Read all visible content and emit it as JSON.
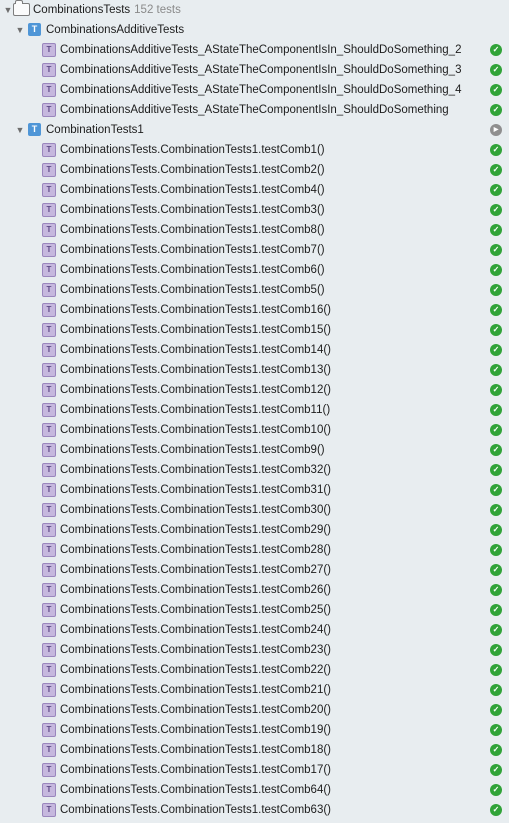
{
  "root": {
    "label": "CombinationsTests",
    "count": "152 tests",
    "disclosure": "▼"
  },
  "groups": [
    {
      "label": "CombinationsAdditiveTests",
      "disclosure": "▼",
      "icon_text": "T",
      "status": "",
      "tests": [
        {
          "label": "CombinationsAdditiveTests_AStateTheComponentIsIn_ShouldDoSomething_2",
          "status": "passed"
        },
        {
          "label": "CombinationsAdditiveTests_AStateTheComponentIsIn_ShouldDoSomething_3",
          "status": "passed"
        },
        {
          "label": "CombinationsAdditiveTests_AStateTheComponentIsIn_ShouldDoSomething_4",
          "status": "passed"
        },
        {
          "label": "CombinationsAdditiveTests_AStateTheComponentIsIn_ShouldDoSomething",
          "status": "passed"
        }
      ]
    },
    {
      "label": "CombinationTests1",
      "disclosure": "▼",
      "icon_text": "T",
      "status": "run",
      "tests": [
        {
          "label": "CombinationsTests.CombinationTests1.testComb1()",
          "status": "passed"
        },
        {
          "label": "CombinationsTests.CombinationTests1.testComb2()",
          "status": "passed"
        },
        {
          "label": "CombinationsTests.CombinationTests1.testComb4()",
          "status": "passed"
        },
        {
          "label": "CombinationsTests.CombinationTests1.testComb3()",
          "status": "passed"
        },
        {
          "label": "CombinationsTests.CombinationTests1.testComb8()",
          "status": "passed"
        },
        {
          "label": "CombinationsTests.CombinationTests1.testComb7()",
          "status": "passed"
        },
        {
          "label": "CombinationsTests.CombinationTests1.testComb6()",
          "status": "passed"
        },
        {
          "label": "CombinationsTests.CombinationTests1.testComb5()",
          "status": "passed"
        },
        {
          "label": "CombinationsTests.CombinationTests1.testComb16()",
          "status": "passed"
        },
        {
          "label": "CombinationsTests.CombinationTests1.testComb15()",
          "status": "passed"
        },
        {
          "label": "CombinationsTests.CombinationTests1.testComb14()",
          "status": "passed"
        },
        {
          "label": "CombinationsTests.CombinationTests1.testComb13()",
          "status": "passed"
        },
        {
          "label": "CombinationsTests.CombinationTests1.testComb12()",
          "status": "passed"
        },
        {
          "label": "CombinationsTests.CombinationTests1.testComb11()",
          "status": "passed"
        },
        {
          "label": "CombinationsTests.CombinationTests1.testComb10()",
          "status": "passed"
        },
        {
          "label": "CombinationsTests.CombinationTests1.testComb9()",
          "status": "passed"
        },
        {
          "label": "CombinationsTests.CombinationTests1.testComb32()",
          "status": "passed"
        },
        {
          "label": "CombinationsTests.CombinationTests1.testComb31()",
          "status": "passed"
        },
        {
          "label": "CombinationsTests.CombinationTests1.testComb30()",
          "status": "passed"
        },
        {
          "label": "CombinationsTests.CombinationTests1.testComb29()",
          "status": "passed"
        },
        {
          "label": "CombinationsTests.CombinationTests1.testComb28()",
          "status": "passed"
        },
        {
          "label": "CombinationsTests.CombinationTests1.testComb27()",
          "status": "passed"
        },
        {
          "label": "CombinationsTests.CombinationTests1.testComb26()",
          "status": "passed"
        },
        {
          "label": "CombinationsTests.CombinationTests1.testComb25()",
          "status": "passed"
        },
        {
          "label": "CombinationsTests.CombinationTests1.testComb24()",
          "status": "passed"
        },
        {
          "label": "CombinationsTests.CombinationTests1.testComb23()",
          "status": "passed"
        },
        {
          "label": "CombinationsTests.CombinationTests1.testComb22()",
          "status": "passed"
        },
        {
          "label": "CombinationsTests.CombinationTests1.testComb21()",
          "status": "passed"
        },
        {
          "label": "CombinationsTests.CombinationTests1.testComb20()",
          "status": "passed"
        },
        {
          "label": "CombinationsTests.CombinationTests1.testComb19()",
          "status": "passed"
        },
        {
          "label": "CombinationsTests.CombinationTests1.testComb18()",
          "status": "passed"
        },
        {
          "label": "CombinationsTests.CombinationTests1.testComb17()",
          "status": "passed"
        },
        {
          "label": "CombinationsTests.CombinationTests1.testComb64()",
          "status": "passed"
        },
        {
          "label": "CombinationsTests.CombinationTests1.testComb63()",
          "status": "passed"
        }
      ]
    }
  ],
  "icons": {
    "test": "T",
    "passed": "✓",
    "run": "▶"
  },
  "colors": {
    "background": "#e8edf0",
    "passed": "#31a338",
    "class_icon": "#4f96d7",
    "test_icon": "#c6b8de",
    "run": "#8f8f8f"
  }
}
